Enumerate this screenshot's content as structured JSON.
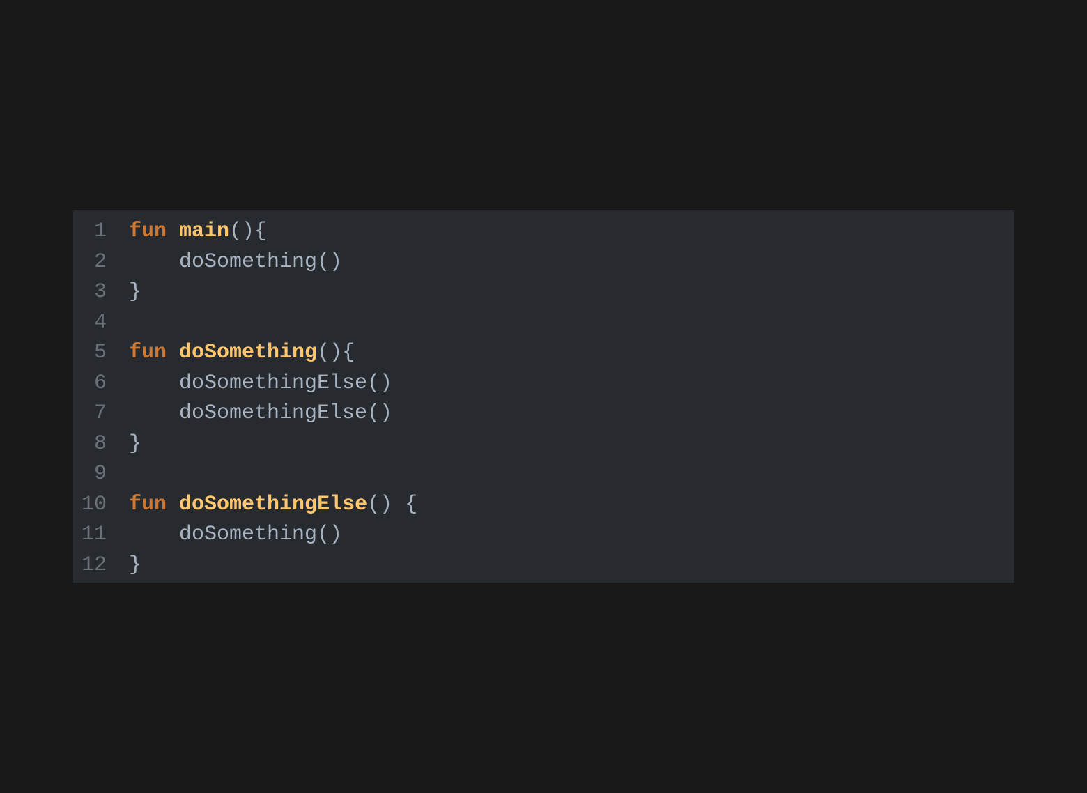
{
  "colors": {
    "background": "#191919",
    "editor_background": "#272a2e",
    "gutter_text": "#6c7079",
    "keyword": "#cc7832",
    "function_name": "#ffc66d",
    "plain_text": "#a9b4c2"
  },
  "code": {
    "lines": [
      {
        "number": "1",
        "tokens": [
          {
            "type": "kw",
            "text": "fun"
          },
          {
            "type": "plain",
            "text": " "
          },
          {
            "type": "fn",
            "text": "main"
          },
          {
            "type": "plain",
            "text": "(){"
          }
        ]
      },
      {
        "number": "2",
        "tokens": [
          {
            "type": "plain",
            "text": "    doSomething()"
          }
        ]
      },
      {
        "number": "3",
        "tokens": [
          {
            "type": "plain",
            "text": "}"
          }
        ]
      },
      {
        "number": "4",
        "tokens": []
      },
      {
        "number": "5",
        "tokens": [
          {
            "type": "kw",
            "text": "fun"
          },
          {
            "type": "plain",
            "text": " "
          },
          {
            "type": "fn",
            "text": "doSomething"
          },
          {
            "type": "plain",
            "text": "(){"
          }
        ]
      },
      {
        "number": "6",
        "tokens": [
          {
            "type": "plain",
            "text": "    doSomethingElse()"
          }
        ]
      },
      {
        "number": "7",
        "tokens": [
          {
            "type": "plain",
            "text": "    doSomethingElse()"
          }
        ]
      },
      {
        "number": "8",
        "tokens": [
          {
            "type": "plain",
            "text": "}"
          }
        ]
      },
      {
        "number": "9",
        "tokens": []
      },
      {
        "number": "10",
        "tokens": [
          {
            "type": "kw",
            "text": "fun"
          },
          {
            "type": "plain",
            "text": " "
          },
          {
            "type": "fn",
            "text": "doSomethingElse"
          },
          {
            "type": "plain",
            "text": "() {"
          }
        ]
      },
      {
        "number": "11",
        "tokens": [
          {
            "type": "plain",
            "text": "    doSomething()"
          }
        ]
      },
      {
        "number": "12",
        "tokens": [
          {
            "type": "plain",
            "text": "}"
          }
        ]
      }
    ]
  }
}
